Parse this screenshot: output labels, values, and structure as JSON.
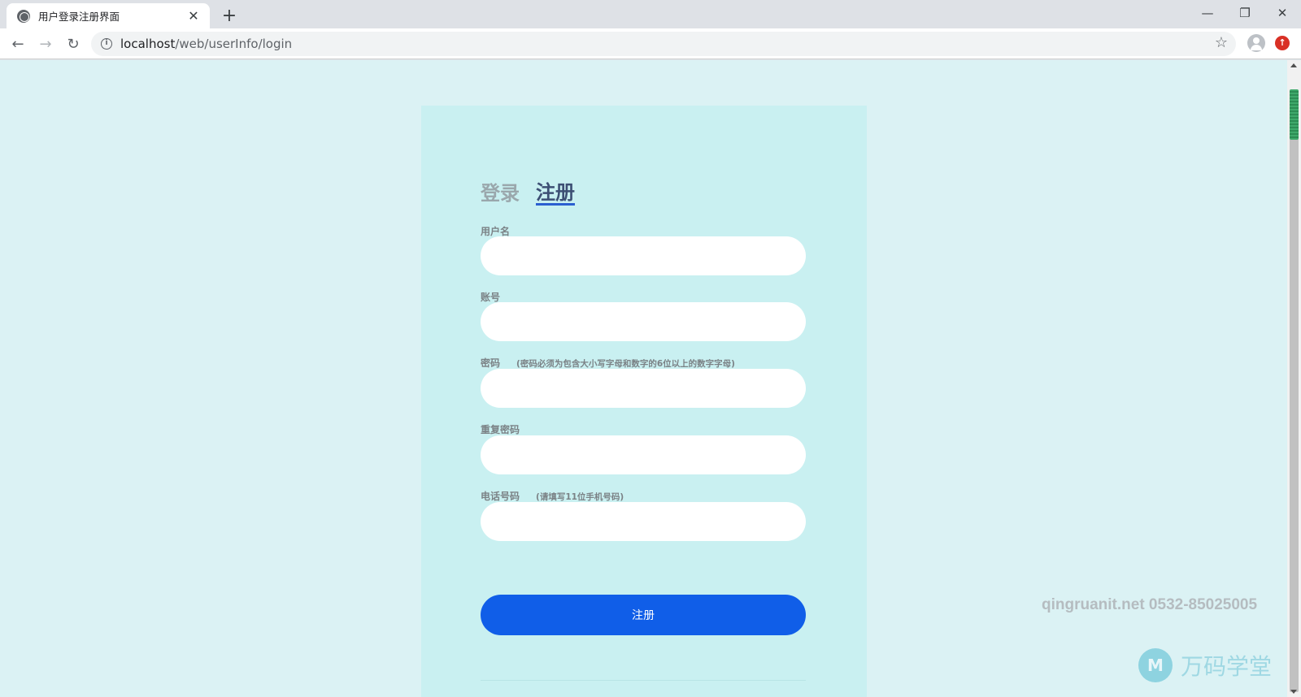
{
  "browser": {
    "tab_title": "用户登录注册界面",
    "tab_close": "✕",
    "new_tab": "+",
    "url_host": "localhost",
    "url_path": "/web/userInfo/login",
    "window_controls": {
      "minimize": "—",
      "restore": "❐",
      "close": "✕"
    },
    "nav": {
      "back": "←",
      "forward": "→",
      "reload": "↻"
    },
    "star": "☆",
    "info_icon": "i",
    "update_icon": "↑"
  },
  "form": {
    "tabs": {
      "login": "登录",
      "register": "注册"
    },
    "fields": [
      {
        "label": "用户名",
        "hint": "",
        "value": ""
      },
      {
        "label": "账号",
        "hint": "",
        "value": ""
      },
      {
        "label": "密码",
        "hint": "(密码必须为包含大小写字母和数字的6位以上的数字字母)",
        "value": ""
      },
      {
        "label": "重复密码",
        "hint": "",
        "value": ""
      },
      {
        "label": "电话号码",
        "hint": "(请填写11位手机号码)",
        "value": ""
      }
    ],
    "submit_label": "注册"
  },
  "watermark": {
    "contact": "qingruanit.net 0532-85025005",
    "brand": "万码学堂",
    "mark": "M"
  }
}
